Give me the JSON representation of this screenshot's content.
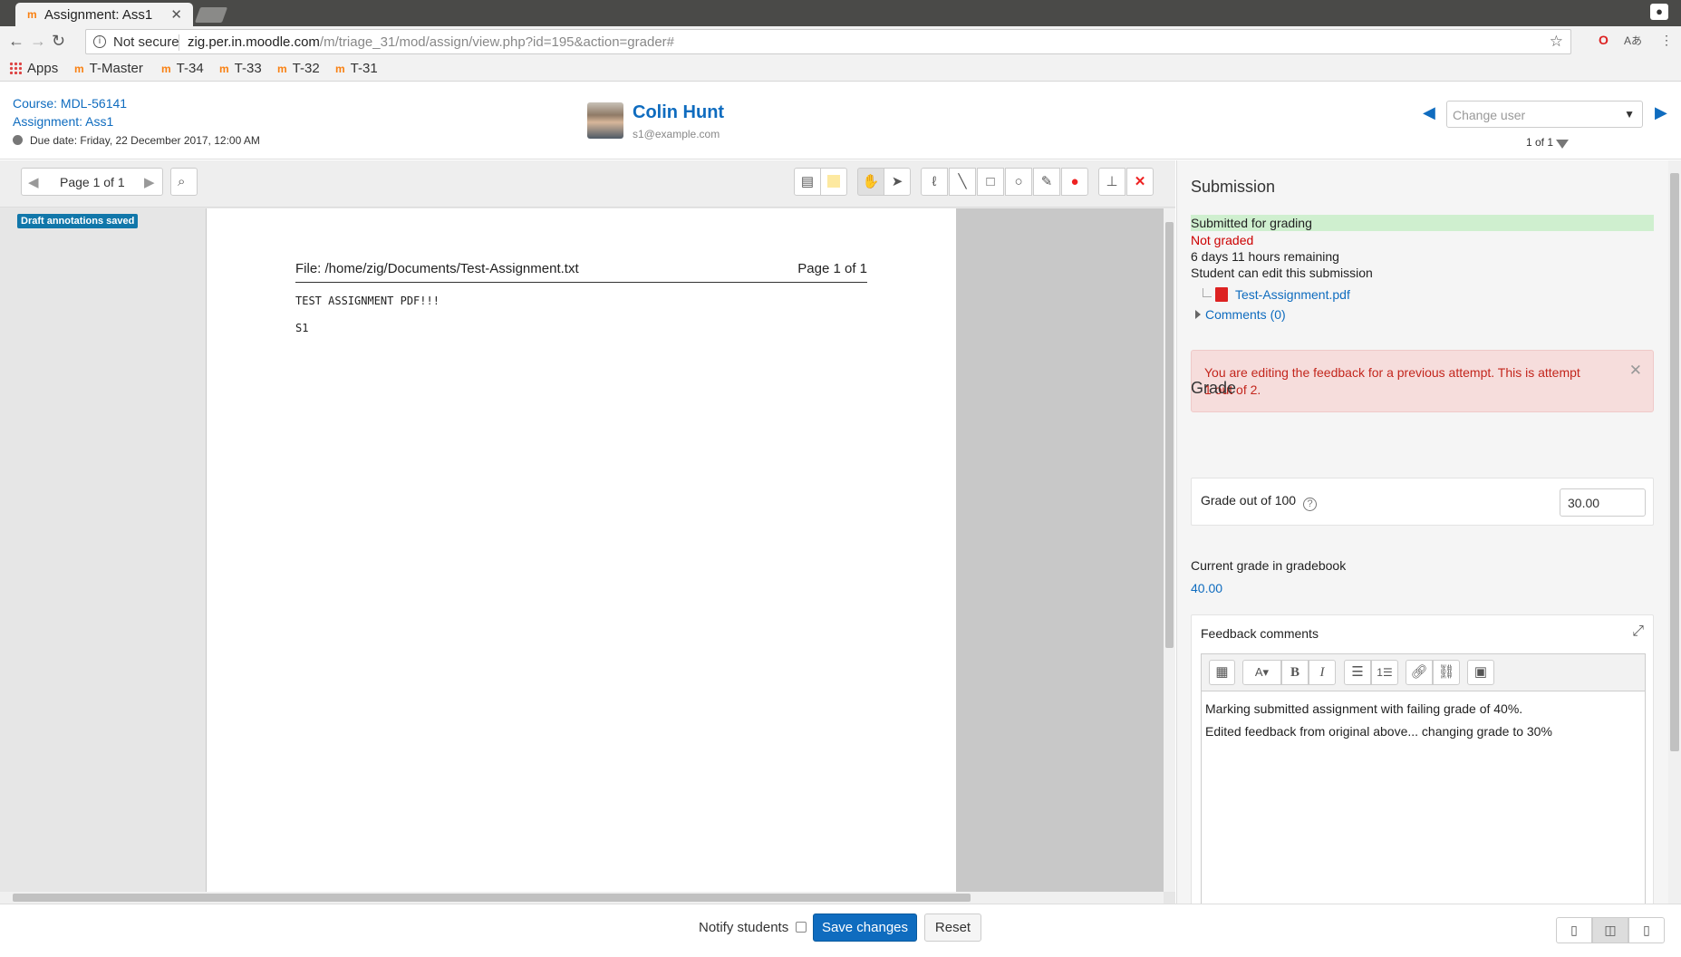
{
  "browser": {
    "tab_title": "Assignment: Ass1",
    "url_security": "Not secure",
    "url_host": "zig.per.in.moodle.com",
    "url_path": "/m/triage_31/mod/assign/view.php?id=195&action=grader#",
    "bookmarks": [
      "Apps",
      "T-Master",
      "T-34",
      "T-33",
      "T-32",
      "T-31"
    ]
  },
  "header": {
    "course_link": "Course: MDL-56141",
    "assignment_link": "Assignment: Ass1",
    "due_date": "Due date: Friday, 22 December 2017, 12:00 AM",
    "user_name": "Colin Hunt",
    "user_email": "s1@example.com",
    "change_user_placeholder": "Change user",
    "user_index": "1 of 1"
  },
  "editor": {
    "page_label": "Page 1 of 1",
    "draft_badge": "Draft annotations saved",
    "doc_file": "File: /home/zig/Documents/Test-Assignment.txt",
    "doc_page": "Page 1 of 1",
    "doc_line1": "TEST ASSIGNMENT PDF!!!",
    "doc_line2": "S1"
  },
  "submission": {
    "heading": "Submission",
    "status_submitted": "Submitted for grading",
    "status_graded": "Not graded",
    "time_remaining": "6 days 11 hours remaining",
    "edit_status": "Student can edit this submission",
    "file_name": "Test-Assignment.pdf",
    "comments_link": "Comments (0)",
    "alert": "You are editing the feedback for a previous attempt. This is attempt 1 out of 2."
  },
  "grade": {
    "heading": "Grade",
    "label": "Grade out of 100",
    "value": "30.00",
    "current_label": "Current grade in gradebook",
    "current_value": "40.00"
  },
  "feedback": {
    "title": "Feedback comments",
    "line1": "Marking submitted assignment with failing grade of 40%.",
    "line2": "Edited feedback from original above... changing grade to 30%"
  },
  "footer": {
    "notify_label": "Notify students",
    "save_label": "Save changes",
    "reset_label": "Reset"
  },
  "colors": {
    "link": "#0f6cbf",
    "submitted_bg": "#cfefcf",
    "not_graded": "#cc0000",
    "alert_bg": "#f6dddc",
    "alert_text": "#c3261d",
    "draft_badge": "#1177aa"
  }
}
